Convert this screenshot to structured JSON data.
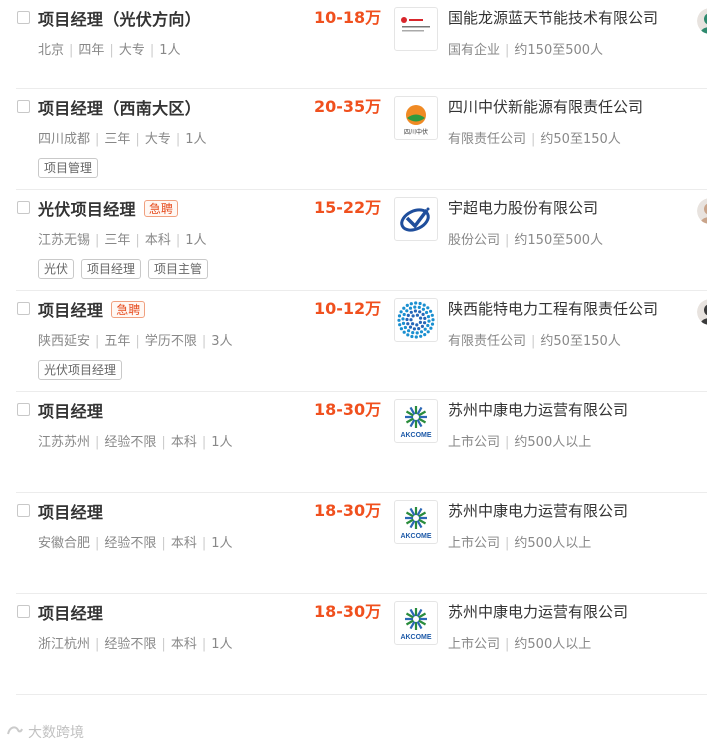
{
  "jobs": [
    {
      "title": "项目经理（光伏方向）",
      "urgent": "",
      "salary": "10-18万",
      "meta": [
        "北京",
        "四年",
        "大专",
        "1人"
      ],
      "tags": [],
      "company": "国能龙源蓝天节能技术有限公司",
      "company_meta": [
        "国有企业",
        "约150至500人"
      ],
      "logo": "longyuan-logo",
      "avatar": true
    },
    {
      "title": "项目经理（西南大区）",
      "urgent": "",
      "salary": "20-35万",
      "meta": [
        "四川成都",
        "三年",
        "大专",
        "1人"
      ],
      "tags": [
        "项目管理"
      ],
      "company": "四川中伏新能源有限责任公司",
      "company_meta": [
        "有限责任公司",
        "约50至150人"
      ],
      "logo": "zhongfu-logo",
      "avatar": false
    },
    {
      "title": "光伏项目经理",
      "urgent": "急聘",
      "salary": "15-22万",
      "meta": [
        "江苏无锡",
        "三年",
        "本科",
        "1人"
      ],
      "tags": [
        "光伏",
        "项目经理",
        "项目主管"
      ],
      "company": "宇超电力股份有限公司",
      "company_meta": [
        "股份公司",
        "约150至500人"
      ],
      "logo": "yuchao-logo",
      "avatar": true
    },
    {
      "title": "项目经理",
      "urgent": "急聘",
      "salary": "10-12万",
      "meta": [
        "陕西延安",
        "五年",
        "学历不限",
        "3人"
      ],
      "tags": [
        "光伏项目经理"
      ],
      "company": "陕西能特电力工程有限责任公司",
      "company_meta": [
        "有限责任公司",
        "约50至150人"
      ],
      "logo": "nengte-logo",
      "avatar": true
    },
    {
      "title": "项目经理",
      "urgent": "",
      "salary": "18-30万",
      "meta": [
        "江苏苏州",
        "经验不限",
        "本科",
        "1人"
      ],
      "tags": [],
      "company": "苏州中康电力运营有限公司",
      "company_meta": [
        "上市公司",
        "约500人以上"
      ],
      "logo": "akcome-logo",
      "avatar": false
    },
    {
      "title": "项目经理",
      "urgent": "",
      "salary": "18-30万",
      "meta": [
        "安徽合肥",
        "经验不限",
        "本科",
        "1人"
      ],
      "tags": [],
      "company": "苏州中康电力运营有限公司",
      "company_meta": [
        "上市公司",
        "约500人以上"
      ],
      "logo": "akcome-logo",
      "avatar": false
    },
    {
      "title": "项目经理",
      "urgent": "",
      "salary": "18-30万",
      "meta": [
        "浙江杭州",
        "经验不限",
        "本科",
        "1人"
      ],
      "tags": [],
      "company": "苏州中康电力运营有限公司",
      "company_meta": [
        "上市公司",
        "约500人以上"
      ],
      "logo": "akcome-logo",
      "avatar": false
    }
  ],
  "logo_text": {
    "zhongfu": "四川中伏",
    "akcome": "AKCOME"
  },
  "watermark": "大数跨境",
  "colors": {
    "salary": "#f0501e",
    "urgent": "#e64c1e",
    "meta": "#888888"
  }
}
